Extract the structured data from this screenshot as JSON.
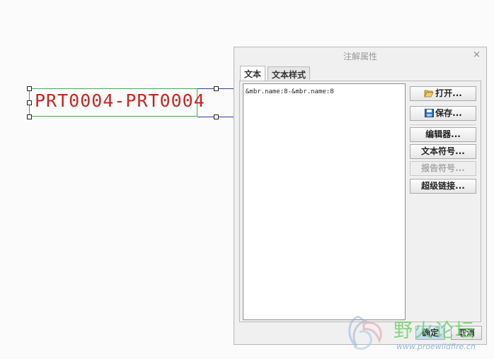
{
  "canvas": {
    "note_text": "PRT0004-PRT0004",
    "note_color": "#c8261f",
    "box_color": "#2fb84a",
    "leader_color": "#2a3ea8"
  },
  "dialog": {
    "title": "注解属性",
    "close_glyph": "×",
    "tabs": [
      {
        "label": "文本",
        "active": true
      },
      {
        "label": "文本样式",
        "active": false
      }
    ],
    "text_content": "&mbr.name:8-&mbr.name:8",
    "buttons": {
      "open": "打开...",
      "save": "保存...",
      "editor": "编辑器...",
      "text_symbol": "文本符号...",
      "report_symbol": "报告符号...",
      "hyperlink": "超级链接..."
    },
    "ok": "确定",
    "cancel": "取消"
  },
  "watermark": {
    "title": "野火论坛",
    "url": "www.proewildfire.cn"
  }
}
